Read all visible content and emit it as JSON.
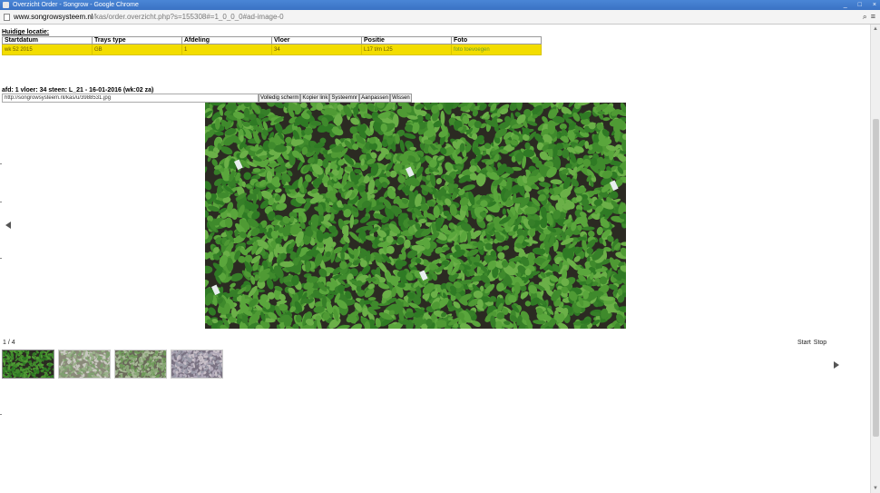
{
  "window": {
    "title": "Overzicht Order - Songrow - Google Chrome",
    "controls": [
      "_",
      "□",
      "×"
    ]
  },
  "address": {
    "host": "www.songrowsysteem.nl",
    "path": "/kas/order.overzicht.php?s=155308#=1_0_0_0#ad-image-0"
  },
  "location": {
    "heading": "Huidige locatie:",
    "columns": [
      "Startdatum",
      "Trays type",
      "Afdeling",
      "Vloer",
      "Positie",
      "Foto"
    ],
    "row": [
      "wk 52 2015",
      "GB",
      "1",
      "34",
      "L17 t/m L25",
      "foto toevoegen"
    ]
  },
  "photo": {
    "caption": "afd: 1 vloer: 34 steen: L_21 - 16-01-2016 (wk:02 za)",
    "url": "http://songrowsysteem.nl/kas/u/3988531.jpg",
    "buttons": [
      "Volledig scherm",
      "Kopier link",
      "Systeemnr",
      "Aanpassen",
      "Wissen"
    ]
  },
  "gallery": {
    "counter": "1 / 4",
    "start_label": "Start",
    "stop_label": "Stop",
    "thumbnails": [
      "thumb-1",
      "thumb-2",
      "thumb-3",
      "thumb-4"
    ],
    "active_index": 0
  },
  "colors": {
    "highlight": "#f3dd00",
    "plant_green": "#3f8a2c",
    "soil": "#2b2a22",
    "titlebar": "#3a72c4"
  }
}
